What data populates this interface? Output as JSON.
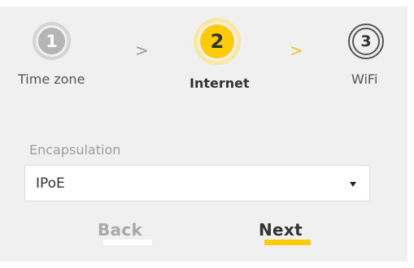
{
  "wizard": {
    "steps": [
      {
        "number": "1",
        "label": "Time zone",
        "state": "completed"
      },
      {
        "number": "2",
        "label": "Internet",
        "state": "current"
      },
      {
        "number": "3",
        "label": "WiFi",
        "state": "upcoming"
      }
    ],
    "separators": [
      ">",
      ">"
    ]
  },
  "form": {
    "encapsulation_label": "Encapsulation",
    "encapsulation_value": "IPoE"
  },
  "buttons": {
    "back_label": "Back",
    "next_label": "Next"
  },
  "colors": {
    "accent": "#fdcb08",
    "panel_bg": "#f0f0f0",
    "completed_step": "#b5b5b5"
  }
}
